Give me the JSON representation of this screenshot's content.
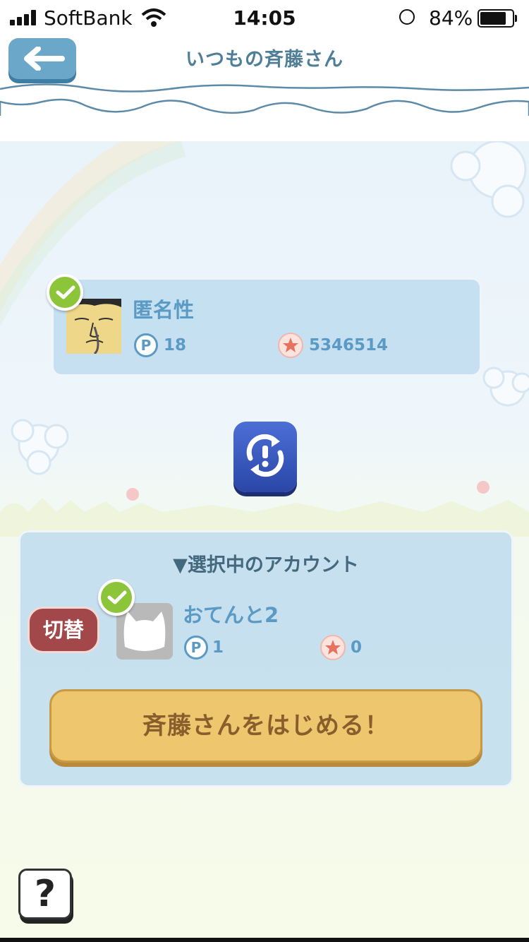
{
  "status_bar": {
    "carrier": "SoftBank",
    "time": "14:05",
    "battery": "84%",
    "battery_level": 0.84
  },
  "header": {
    "title": "いつもの斉藤さん",
    "back_icon": "arrow-left-icon"
  },
  "linked_account": {
    "name": "匿名性",
    "points_icon": "P",
    "points": "18",
    "stars": "5346514",
    "checked": true
  },
  "swap_icon": "swap-icon",
  "selected_section": {
    "header": "▼選択中のアカウント",
    "switch_label": "切替",
    "account": {
      "name": "おてんと2",
      "points_icon": "P",
      "points": "1",
      "stars": "0",
      "checked": true
    },
    "start_label": "斉藤さんをはじめる！"
  },
  "help_label": "?",
  "colors": {
    "accent_blue": "#5a9ac4",
    "panel_bg": "#c3dff0",
    "start_button": "#edc66d",
    "switch_button": "#a3484a",
    "swap_button": "#3b5bc4"
  }
}
